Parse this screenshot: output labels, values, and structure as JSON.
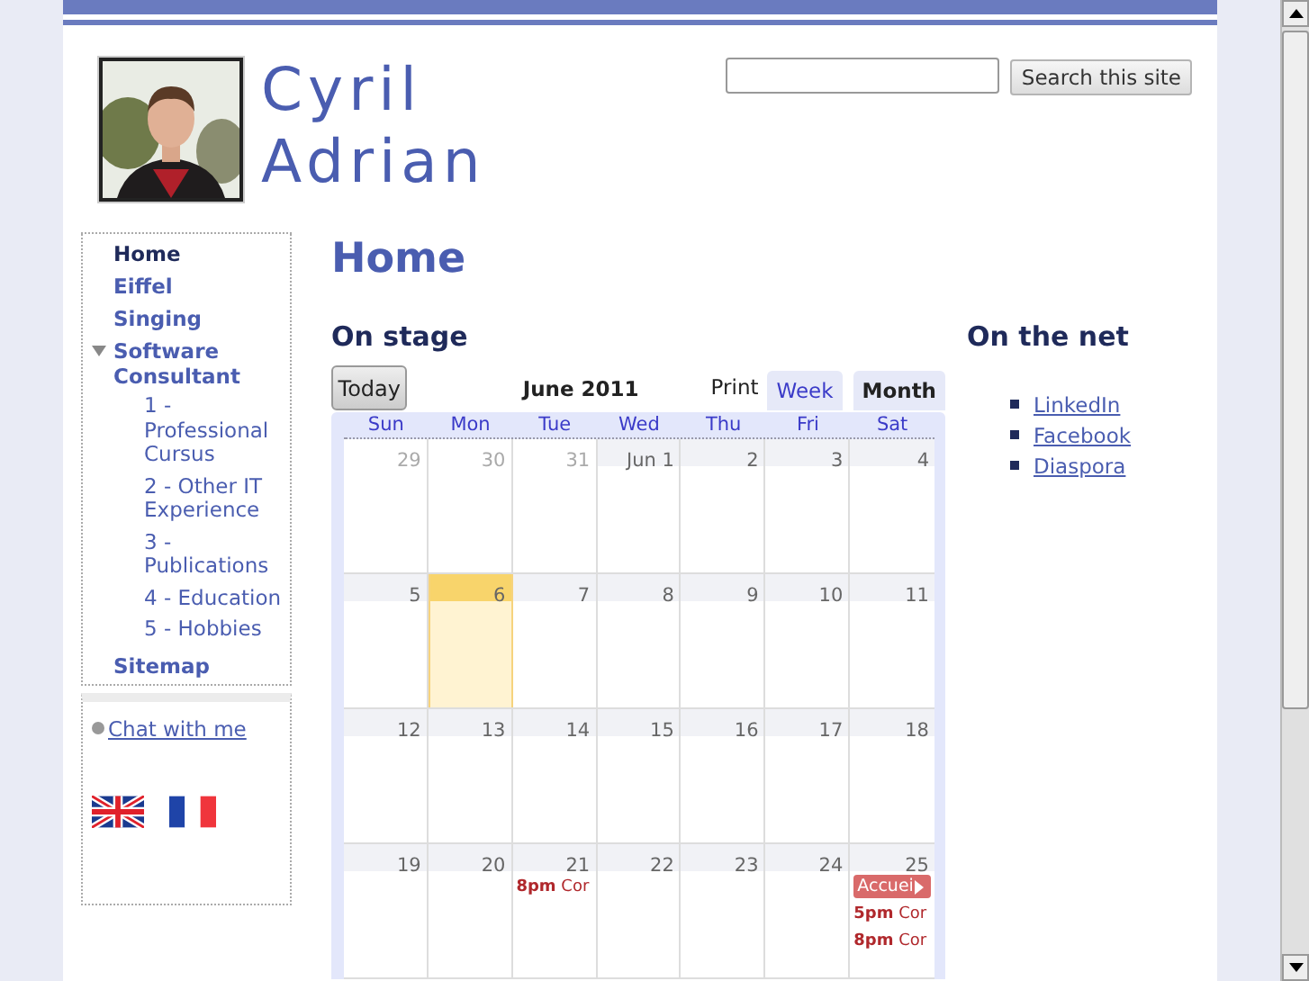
{
  "header": {
    "name_lines": [
      "Cyril",
      "Adrian"
    ],
    "photo": {
      "kind": "picture"
    },
    "search": {
      "button": "Search this site"
    }
  },
  "sidebar": {
    "items": [
      {
        "label": "Home",
        "selected": true
      },
      {
        "label": "Eiffel",
        "selected": false
      },
      {
        "label": "Singing",
        "selected": false
      },
      {
        "label": "Software Consultant",
        "selected": false,
        "expanded": true,
        "children": [
          {
            "label": "1 - Professional Cursus",
            "selected": false
          },
          {
            "label": "2 - Other IT Experience",
            "selected": false
          },
          {
            "label": "3 - Publications",
            "selected": false
          },
          {
            "label": "4 - Education",
            "selected": false
          },
          {
            "label": "5 - Hobbies",
            "selected": false
          }
        ]
      },
      {
        "label": "Sitemap",
        "selected": false
      }
    ],
    "chat": {
      "label": "Chat with me",
      "online": false
    },
    "languages": [
      {
        "kind": "uk"
      },
      {
        "kind": "fr"
      }
    ]
  },
  "page_title": "Home",
  "on_stage": {
    "title": "On stage",
    "calendar": {
      "today_button": "Today",
      "month": "June 2011",
      "print": "Print",
      "views": [
        {
          "label": "Week",
          "selected": false
        },
        {
          "label": "Month",
          "selected": true
        }
      ],
      "weekdays": [
        "Sun",
        "Mon",
        "Tue",
        "Wed",
        "Thu",
        "Fri",
        "Sat"
      ],
      "weeks": [
        [
          {
            "label": "29",
            "other_month": true,
            "today": false
          },
          {
            "label": "30",
            "other_month": true,
            "today": false
          },
          {
            "label": "31",
            "other_month": true,
            "today": false
          },
          {
            "label": "Jun 1",
            "other_month": false,
            "today": false
          },
          {
            "label": "2",
            "other_month": false,
            "today": false
          },
          {
            "label": "3",
            "other_month": false,
            "today": false
          },
          {
            "label": "4",
            "other_month": false,
            "today": false
          }
        ],
        [
          {
            "label": "5",
            "other_month": false,
            "today": false
          },
          {
            "label": "6",
            "other_month": false,
            "today": true
          },
          {
            "label": "7",
            "other_month": false,
            "today": false
          },
          {
            "label": "8",
            "other_month": false,
            "today": false
          },
          {
            "label": "9",
            "other_month": false,
            "today": false
          },
          {
            "label": "10",
            "other_month": false,
            "today": false
          },
          {
            "label": "11",
            "other_month": false,
            "today": false
          }
        ],
        [
          {
            "label": "12",
            "other_month": false,
            "today": false
          },
          {
            "label": "13",
            "other_month": false,
            "today": false
          },
          {
            "label": "14",
            "other_month": false,
            "today": false
          },
          {
            "label": "15",
            "other_month": false,
            "today": false
          },
          {
            "label": "16",
            "other_month": false,
            "today": false
          },
          {
            "label": "17",
            "other_month": false,
            "today": false
          },
          {
            "label": "18",
            "other_month": false,
            "today": false
          }
        ],
        [
          {
            "label": "19",
            "other_month": false,
            "today": false
          },
          {
            "label": "20",
            "other_month": false,
            "today": false
          },
          {
            "label": "21",
            "other_month": false,
            "today": false,
            "events": [
              {
                "kind": "timed",
                "time": "8pm",
                "title": "Cor"
              }
            ]
          },
          {
            "label": "22",
            "other_month": false,
            "today": false
          },
          {
            "label": "23",
            "other_month": false,
            "today": false
          },
          {
            "label": "24",
            "other_month": false,
            "today": false
          },
          {
            "label": "25",
            "other_month": false,
            "today": false,
            "events": [
              {
                "kind": "allday",
                "title": "Accuei"
              },
              {
                "kind": "timed",
                "time": "5pm",
                "title": "Cor"
              },
              {
                "kind": "timed",
                "time": "8pm",
                "title": "Cor"
              }
            ]
          }
        ]
      ]
    }
  },
  "on_the_net": {
    "title": "On the net",
    "links": [
      "LinkedIn",
      "Facebook",
      "Diaspora"
    ]
  }
}
